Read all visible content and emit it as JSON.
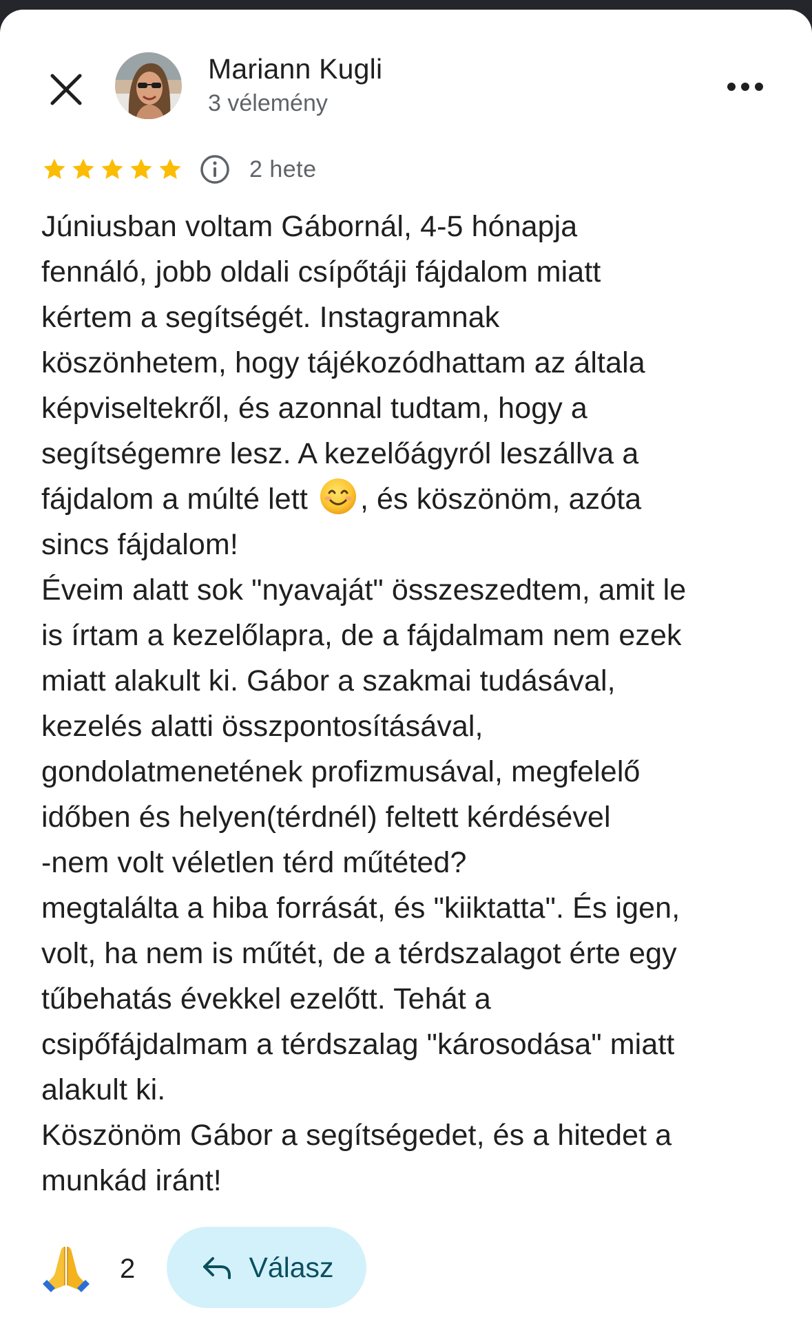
{
  "author": {
    "name": "Mariann Kugli",
    "meta": "3 vélemény"
  },
  "review": {
    "rating": 5,
    "max_rating": 5,
    "date": "2 hete",
    "lines": [
      "Júniusban voltam Gábornál, 4-5 hónapja",
      "fennáló, jobb oldali csípőtáji fájdalom miatt",
      "kértem a segítségét. Instagramnak",
      "köszönhetem, hogy tájékozódhattam az általa",
      "képviseltekről, és azonnal tudtam, hogy a",
      "segítségemre lesz. A kezelőágyról leszállva a",
      {
        "before": "fájdalom a múlté lett ",
        "emoji": "smiling-face",
        "after": ", és köszönöm, azóta"
      },
      "sincs fájdalom!",
      "Éveim alatt sok \"nyavaját\" összeszedtem, amit le",
      "is írtam a kezelőlapra, de a fájdalmam nem ezek",
      "miatt alakult ki. Gábor a szakmai tudásával,",
      "kezelés alatti összpontosításával,",
      "gondolatmenetének profizmusával, megfelelő",
      "időben és helyen(térdnél) feltett kérdésével",
      "-nem volt véletlen térd műtéted?",
      "megtalálta a hiba forrását, és \"kiiktatta\". És igen,",
      "volt, ha nem is műtét, de a térdszalagot érte egy",
      "tűbehatás évekkel ezelőtt. Tehát a",
      "csipőfájdalmam a térdszalag \"károsodása\" miatt",
      "alakult ki.",
      "Köszönöm Gábor a segítségedet, és a hitedet a",
      "munkád iránt!"
    ]
  },
  "reaction": {
    "icon": "folded-hands-icon",
    "count": "2"
  },
  "reply_button": {
    "label": "Válasz",
    "icon": "reply-arrow-icon"
  },
  "icons": {
    "close": "close-icon",
    "more": "more-options-icon",
    "info": "info-icon",
    "star": "star-icon"
  },
  "colors": {
    "star": "#fbbc04",
    "reply_bg": "#d3f1fa",
    "reply_text": "#0b4f5e",
    "secondary_text": "#5f6368",
    "primary_text": "#1f1f1f",
    "top_bar": "#25262b"
  }
}
